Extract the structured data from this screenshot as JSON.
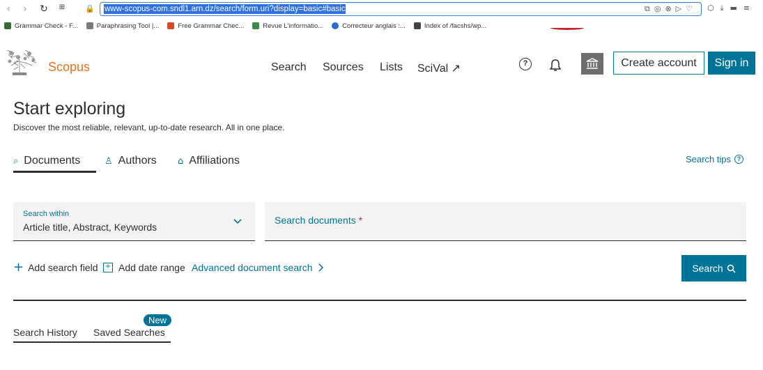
{
  "browser": {
    "url": "www-scopus-com.sndl1.arn.dz/search/form.uri?display=basic#basic",
    "bookmarks": [
      {
        "label": "Grammar Check - F...",
        "color": "#3a6b3a"
      },
      {
        "label": "Paraphrasing Tool |...",
        "color": "#7a7a7a"
      },
      {
        "label": "Free Grammar Chec...",
        "color": "#d94a2a"
      },
      {
        "label": "Revue L'informatio...",
        "color": "#3a8a4a"
      },
      {
        "label": "Correcteur anglais :...",
        "color": "#2a6fd0"
      },
      {
        "label": "Index of /facshs/wp...",
        "color": "#444444"
      }
    ]
  },
  "header": {
    "brand": "Scopus",
    "brand_color": "#e9711c",
    "nav": [
      "Search",
      "Sources",
      "Lists",
      "SciVal ↗"
    ],
    "create_account": "Create account",
    "sign_in": "Sign in",
    "accent": "#007398"
  },
  "main": {
    "title": "Start exploring",
    "subtitle": "Discover the most reliable, relevant, up-to-date research. All in one place.",
    "tabs": [
      {
        "label": "Documents",
        "icon": "document-search-icon",
        "active": true
      },
      {
        "label": "Authors",
        "icon": "person-icon",
        "active": false
      },
      {
        "label": "Affiliations",
        "icon": "institution-icon",
        "active": false
      }
    ],
    "search_tips": "Search tips",
    "search_within_label": "Search within",
    "search_within_value": "Article title, Abstract, Keywords",
    "search_documents_placeholder": "Search documents",
    "required_mark": "*",
    "add_search_field": "Add search field",
    "add_date_range": "Add date range",
    "advanced_search": "Advanced document search",
    "search_button": "Search"
  },
  "history": {
    "badge": "New",
    "tabs": [
      "Search History",
      "Saved Searches"
    ]
  }
}
